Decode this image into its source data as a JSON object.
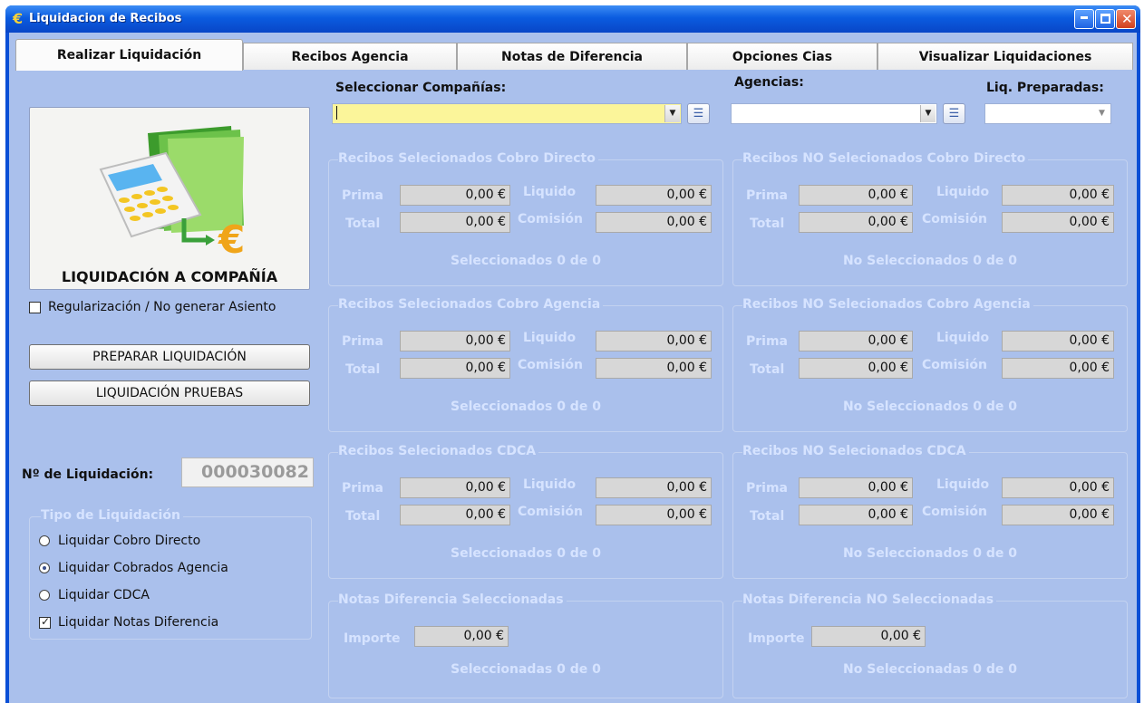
{
  "window": {
    "title": "Liquidacion de Recibos",
    "icon": "euro-icon"
  },
  "tabs": [
    {
      "label": "Realizar Liquidación",
      "active": true
    },
    {
      "label": "Recibos Agencia",
      "active": false
    },
    {
      "label": "Notas de Diferencia",
      "active": false
    },
    {
      "label": "Opciones Cias",
      "active": false
    },
    {
      "label": "Visualizar Liquidaciones",
      "active": false
    }
  ],
  "left": {
    "big_button_label": "LIQUIDACIÓN A COMPAÑÍA",
    "regularizacion_label": "Regularización / No generar Asiento",
    "regularizacion_checked": false,
    "preparar_label": "PREPARAR LIQUIDACIÓN",
    "pruebas_label": "LIQUIDACIÓN PRUEBAS",
    "nliq_label": "Nº de Liquidación:",
    "nliq_value": "000030082",
    "tipo_title": "Tipo de Liquidación",
    "tipo_options": [
      {
        "label": "Liquidar Cobro Directo",
        "kind": "radio",
        "selected": false
      },
      {
        "label": "Liquidar Cobrados Agencia",
        "kind": "radio",
        "selected": true
      },
      {
        "label": "Liquidar CDCA",
        "kind": "radio",
        "selected": false
      },
      {
        "label": "Liquidar Notas Diferencia",
        "kind": "checkbox",
        "selected": true
      }
    ]
  },
  "selectors": {
    "companias_label": "Seleccionar Compañías:",
    "companias_value": "",
    "agencias_label": "Agencias:",
    "agencias_value": "",
    "preparadas_label": "Liq. Preparadas:",
    "preparadas_value": ""
  },
  "labels": {
    "prima": "Prima",
    "liquido": "Liquido",
    "total": "Total",
    "comision": "Comisión",
    "importe": "Importe"
  },
  "groups": {
    "sel_directo": {
      "title": "Recibos Selecionados Cobro Directo",
      "prima": "0,00 €",
      "liquido": "0,00 €",
      "total": "0,00 €",
      "comision": "0,00 €",
      "status": "Seleccionados 0 de 0"
    },
    "nosel_directo": {
      "title": "Recibos NO Selecionados Cobro Directo",
      "prima": "0,00 €",
      "liquido": "0,00 €",
      "total": "0,00 €",
      "comision": "0,00 €",
      "status": "No Seleccionados 0 de 0"
    },
    "sel_agencia": {
      "title": "Recibos Selecionados Cobro Agencia",
      "prima": "0,00 €",
      "liquido": "0,00 €",
      "total": "0,00 €",
      "comision": "0,00 €",
      "status": "Seleccionados 0 de 0"
    },
    "nosel_agencia": {
      "title": "Recibos NO Selecionados Cobro Agencia",
      "prima": "0,00 €",
      "liquido": "0,00 €",
      "total": "0,00 €",
      "comision": "0,00 €",
      "status": "No Seleccionados 0 de 0"
    },
    "sel_cdca": {
      "title": "Recibos Selecionados CDCA",
      "prima": "0,00 €",
      "liquido": "0,00 €",
      "total": "0,00 €",
      "comision": "0,00 €",
      "status": "Seleccionados 0 de 0"
    },
    "nosel_cdca": {
      "title": "Recibos NO Selecionados CDCA",
      "prima": "0,00 €",
      "liquido": "0,00 €",
      "total": "0,00 €",
      "comision": "0,00 €",
      "status": "No Seleccionados 0 de 0"
    },
    "notas_sel": {
      "title": "Notas Diferencia Seleccionadas",
      "importe": "0,00 €",
      "status": "Seleccionadas 0 de 0"
    },
    "notas_nosel": {
      "title": "Notas Diferencia NO Seleccionadas",
      "importe": "0,00 €",
      "status": "No Seleccionadas 0 de 0"
    }
  }
}
